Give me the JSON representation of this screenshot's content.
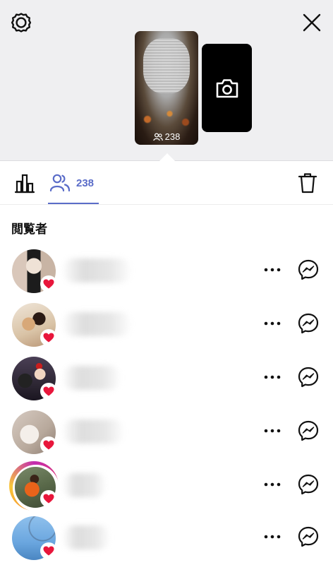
{
  "header": {
    "settings_icon": "gear-icon",
    "close_icon": "close-icon",
    "story_viewer_count": "238",
    "camera_icon": "camera-icon"
  },
  "tabs": {
    "insights_icon": "bar-chart-icon",
    "viewers_icon": "people-icon",
    "viewers_count": "238",
    "delete_icon": "trash-icon"
  },
  "section": {
    "title": "閲覧者"
  },
  "viewers": [
    {
      "liked": true,
      "ring": false
    },
    {
      "liked": true,
      "ring": false
    },
    {
      "liked": true,
      "ring": false
    },
    {
      "liked": true,
      "ring": false
    },
    {
      "liked": true,
      "ring": true
    },
    {
      "liked": true,
      "ring": false
    }
  ],
  "colors": {
    "accent": "#5a6cc8",
    "heart": "#e8163b",
    "header_bg": "#efeff1"
  }
}
